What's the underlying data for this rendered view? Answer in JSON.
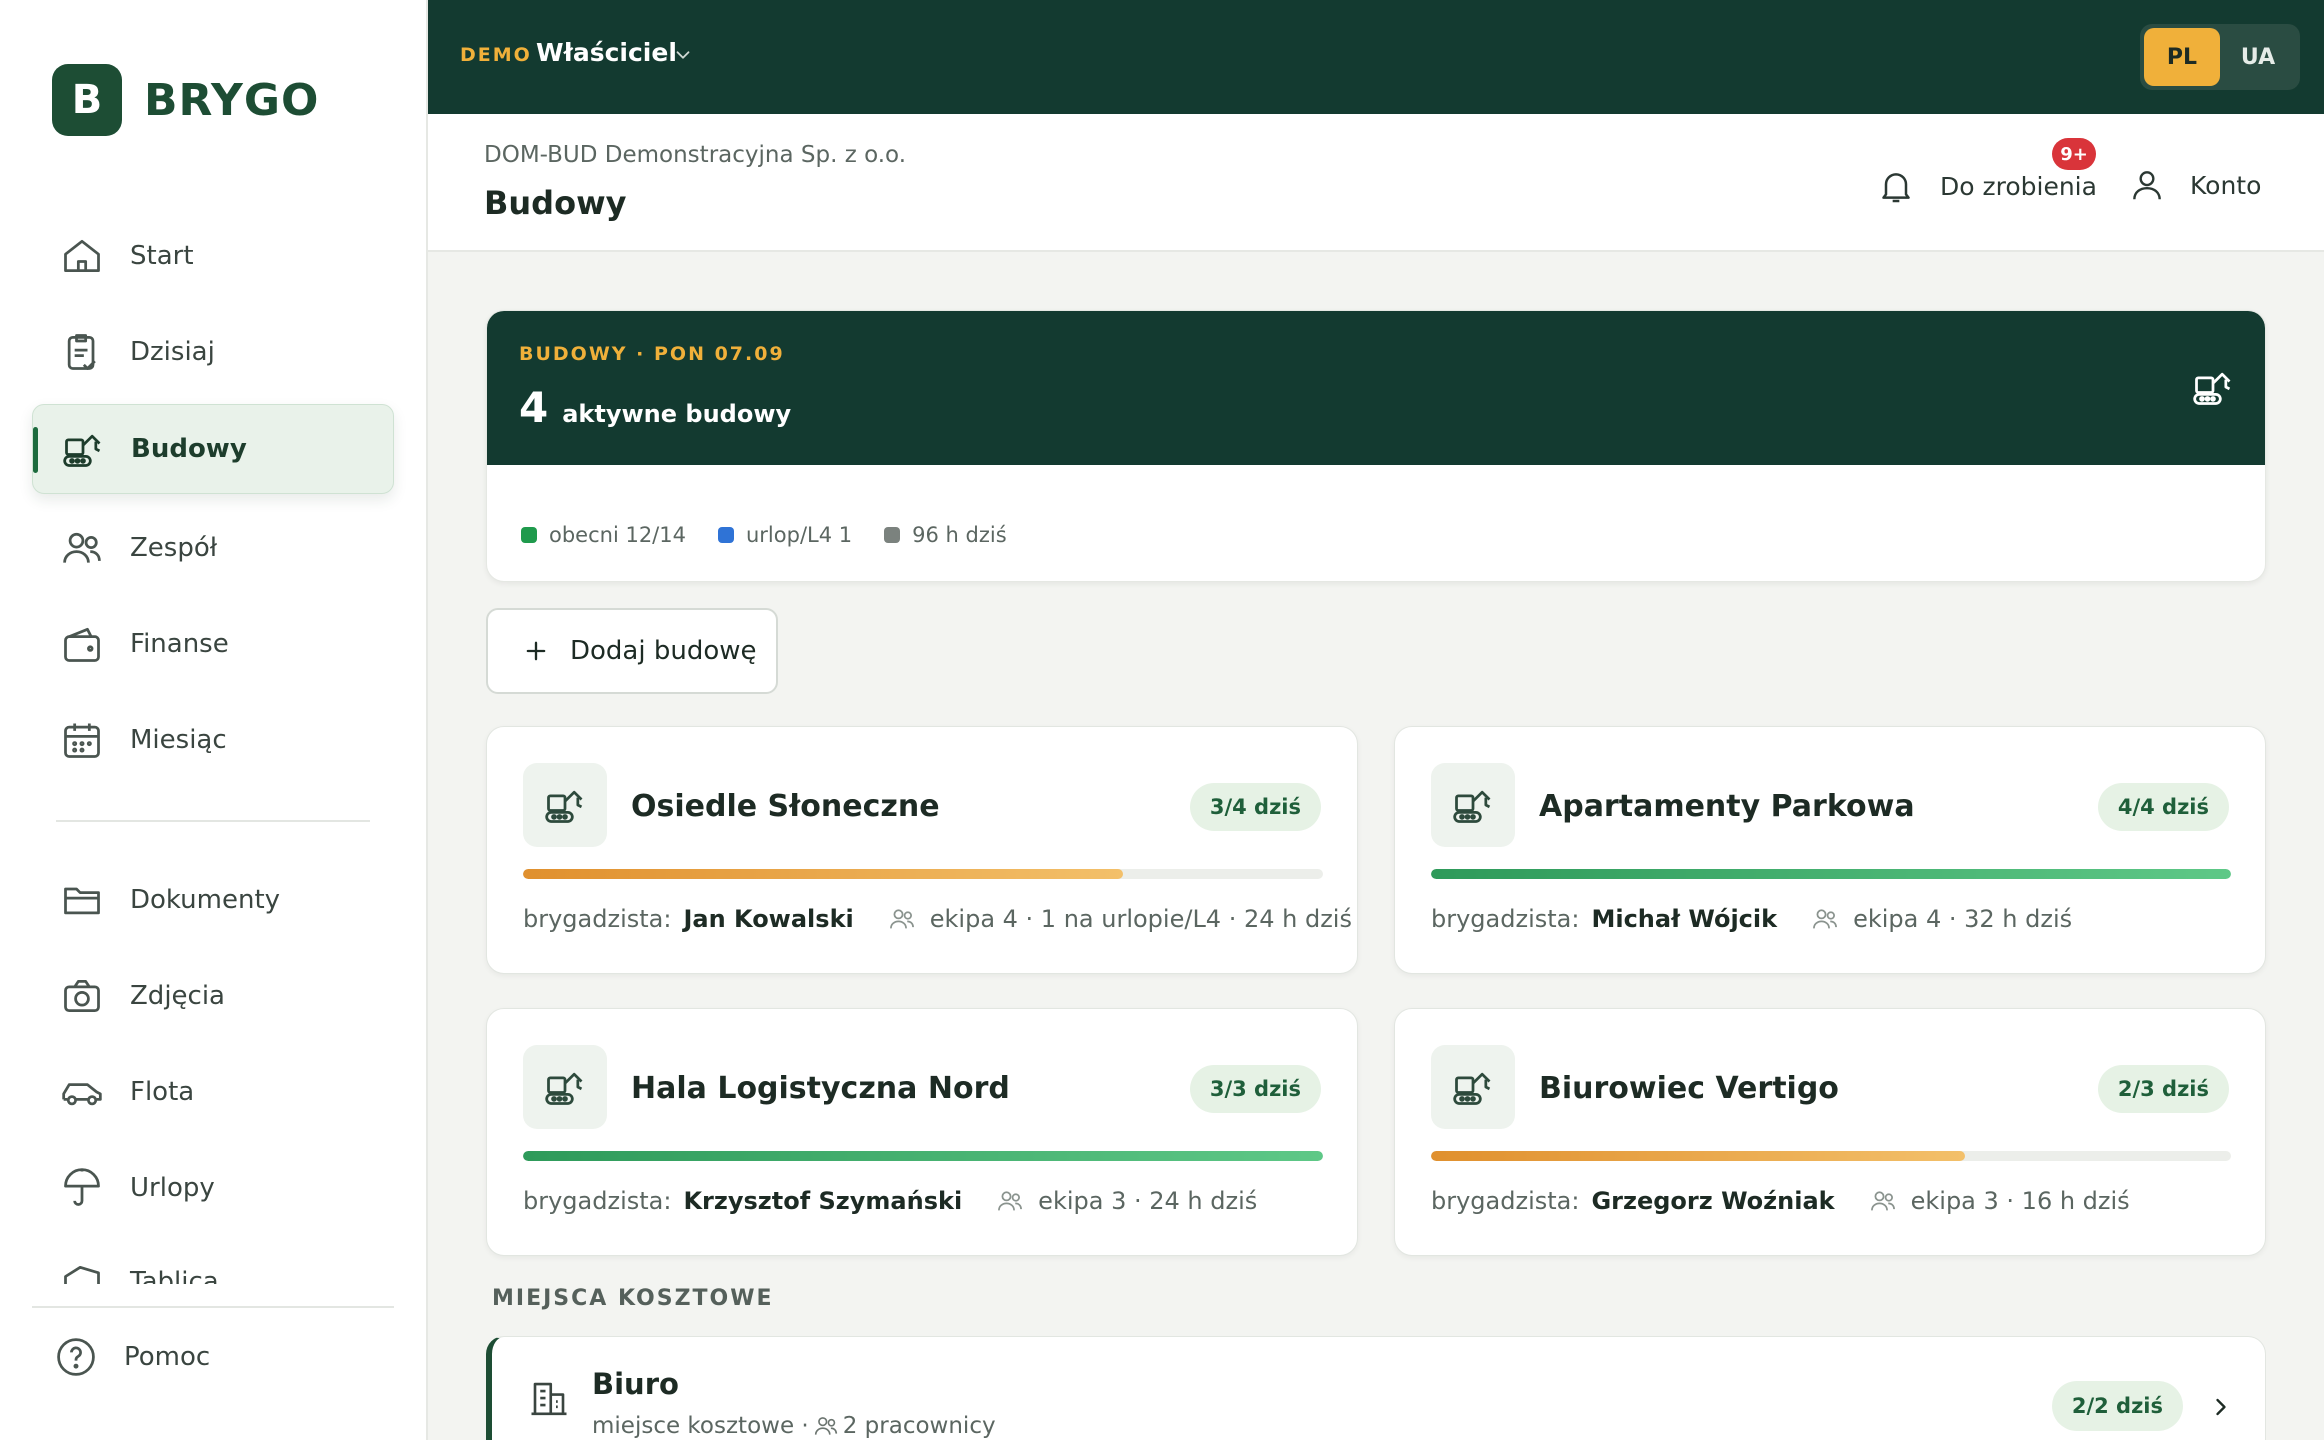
{
  "app": {
    "logo_letter": "B",
    "logo_text": "BRYGO"
  },
  "sidebar": {
    "items": [
      {
        "label": "Start",
        "icon": "home-icon"
      },
      {
        "label": "Dzisiaj",
        "icon": "clipboard-check-icon"
      },
      {
        "label": "Budowy",
        "icon": "excavator-icon",
        "active": true
      },
      {
        "label": "Zespół",
        "icon": "users-icon"
      },
      {
        "label": "Finanse",
        "icon": "wallet-icon"
      },
      {
        "label": "Miesiąc",
        "icon": "calendar-icon"
      },
      {
        "label": "Dokumenty",
        "icon": "folder-icon"
      },
      {
        "label": "Zdjęcia",
        "icon": "camera-icon"
      },
      {
        "label": "Flota",
        "icon": "car-icon"
      },
      {
        "label": "Urlopy",
        "icon": "umbrella-icon"
      },
      {
        "label": "Tablica",
        "icon": "board-icon"
      }
    ],
    "help_label": "Pomoc"
  },
  "topbar": {
    "demo_label": "DEMO",
    "role": "Właściciel",
    "languages": [
      {
        "code": "PL",
        "active": true
      },
      {
        "code": "UA",
        "active": false
      }
    ]
  },
  "header": {
    "company": "DOM-BUD Demonstracyjna Sp. z o.o.",
    "title": "Budowy",
    "todo_label": "Do zrobienia",
    "todo_badge": "9+",
    "account_label": "Konto"
  },
  "summary": {
    "eyebrow": "BUDOWY · PON 07.09",
    "count": "4",
    "count_label": "aktywne budowy",
    "legend": [
      {
        "label": "obecni 12/14",
        "color": "#1f9a4c"
      },
      {
        "label": "urlop/L4 1",
        "color": "#2f73d6"
      },
      {
        "label": "96 h dziś",
        "color": "#7b827e"
      }
    ]
  },
  "add_button_label": "Dodaj budowę",
  "foreman_label": "brygadzista:",
  "sites": [
    {
      "name": "Osiedle Słoneczne",
      "badge": "3/4 dziś",
      "progress": 0.75,
      "foreman": "Jan Kowalski",
      "team": "ekipa 4 · 1 na urlopie/L4 · 24 h dziś"
    },
    {
      "name": "Apartamenty Parkowa",
      "badge": "4/4 dziś",
      "progress": 1.0,
      "foreman": "Michał Wójcik",
      "team": "ekipa 4 · 32 h dziś"
    },
    {
      "name": "Hala Logistyczna Nord",
      "badge": "3/3 dziś",
      "progress": 1.0,
      "foreman": "Krzysztof Szymański",
      "team": "ekipa 3 · 24 h dziś"
    },
    {
      "name": "Biurowiec Vertigo",
      "badge": "2/3 dziś",
      "progress": 0.667,
      "foreman": "Grzegorz Woźniak",
      "team": "ekipa 3 · 16 h dziś"
    }
  ],
  "cost_section": {
    "title": "MIEJSCA KOSZTOWE",
    "items": [
      {
        "name": "Biuro",
        "meta_prefix": "miejsce kosztowe ·",
        "meta_count": "2 pracownicy",
        "badge": "2/2 dziś"
      }
    ]
  }
}
